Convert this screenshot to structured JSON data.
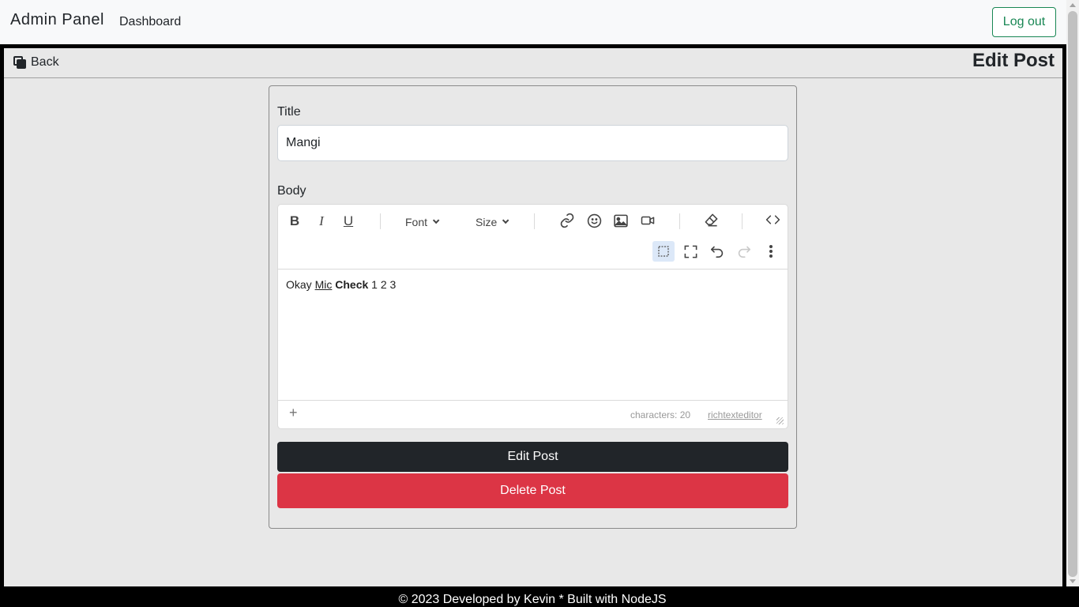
{
  "navbar": {
    "brand": "Admin Panel",
    "dashboard_link": "Dashboard",
    "logout_label": "Log out"
  },
  "subbar": {
    "back_label": "Back",
    "page_title": "Edit Post"
  },
  "form": {
    "title_label": "Title",
    "title_value": "Mangi",
    "body_label": "Body",
    "edit_button": "Edit Post",
    "delete_button": "Delete Post"
  },
  "editor": {
    "toolbar": {
      "bold": "B",
      "italic": "I",
      "underline": "U",
      "font_label": "Font",
      "size_label": "Size"
    },
    "content": {
      "part1": "Okay ",
      "underlined": "Mic",
      "space": " ",
      "bold": "Check",
      "part2": " 1 2 3"
    },
    "status": {
      "characters": "characters: 20",
      "brand_link": "richtexteditor"
    },
    "icons": [
      "bold-icon",
      "italic-icon",
      "underline-icon",
      "link-icon",
      "emoji-icon",
      "image-icon",
      "video-icon",
      "eraser-icon",
      "code-icon",
      "select-all-icon",
      "fullscreen-icon",
      "undo-icon",
      "redo-icon",
      "more-vertical-icon",
      "plus-icon"
    ]
  },
  "footer": {
    "text": "© 2023 Developed by Kevin * Built with NodeJS"
  },
  "colors": {
    "dark": "#212529",
    "danger": "#dc3545",
    "success": "#198754",
    "page_bg": "#e8e8e8",
    "navbar_bg": "#f8f9fa"
  }
}
